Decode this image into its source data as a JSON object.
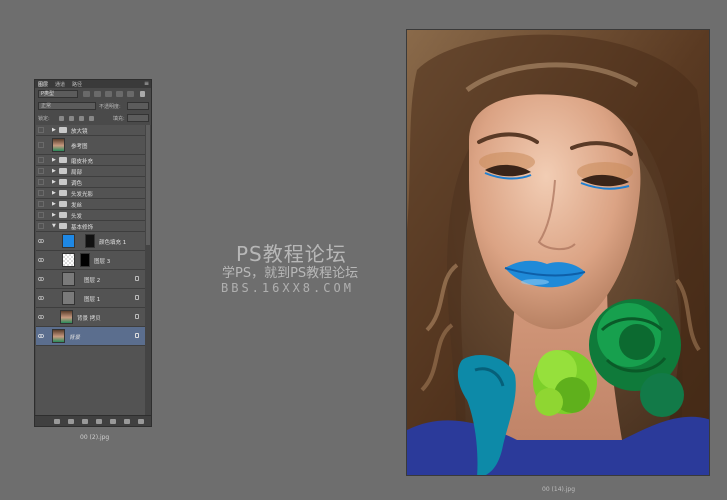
{
  "layers_panel": {
    "tabs": [
      "图层",
      "通道",
      "路径"
    ],
    "filter_value": "P类型",
    "blend_mode": "正常",
    "opacity_label": "不透明度:",
    "lock_label": "锁定:",
    "fill_label": "填充:",
    "layers": [
      {
        "name": "放大镜",
        "type": "group"
      },
      {
        "name": "参考图",
        "type": "image"
      },
      {
        "name": "磨皮补充",
        "type": "group"
      },
      {
        "name": "局部",
        "type": "group"
      },
      {
        "name": "调色",
        "type": "group"
      },
      {
        "name": "头发光影",
        "type": "group"
      },
      {
        "name": "发丝",
        "type": "group"
      },
      {
        "name": "头发",
        "type": "group"
      },
      {
        "name": "基本修饰",
        "type": "group-open"
      },
      {
        "name": "颜色填充 1",
        "type": "fill"
      },
      {
        "name": "图层 3",
        "type": "masked"
      },
      {
        "name": "图层 2",
        "type": "plain"
      },
      {
        "name": "图层 1",
        "type": "plain"
      },
      {
        "name": "背景 拷贝",
        "type": "image"
      },
      {
        "name": "背景",
        "type": "image",
        "selected": true
      }
    ]
  },
  "left_doc_caption": "00 (2).jpg",
  "right_doc_caption": "00 (14).jpg",
  "watermark": {
    "line1": "PS教程论坛",
    "line2": "学PS，就到PS教程论坛",
    "line3": "BBS.16XX8.COM"
  },
  "colors": {
    "background": "#6e6e6e",
    "panel": "#4a4a4a",
    "selection": "#5b6e8e",
    "fill_layer_thumb": "#1e88e5"
  }
}
